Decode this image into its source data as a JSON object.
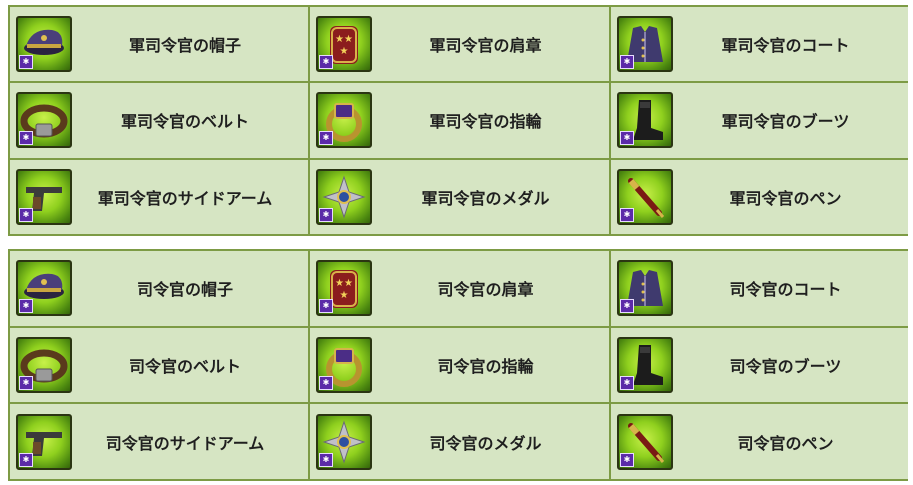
{
  "sections": [
    {
      "items": [
        {
          "label": "軍司令官の帽子",
          "icon": "officer-cap-icon"
        },
        {
          "label": "軍司令官の肩章",
          "icon": "epaulette-icon"
        },
        {
          "label": "軍司令官のコート",
          "icon": "coat-icon"
        },
        {
          "label": "軍司令官のベルト",
          "icon": "belt-icon"
        },
        {
          "label": "軍司令官の指輪",
          "icon": "ring-icon"
        },
        {
          "label": "軍司令官のブーツ",
          "icon": "boot-icon"
        },
        {
          "label": "軍司令官のサイドアーム",
          "icon": "pistol-icon"
        },
        {
          "label": "軍司令官のメダル",
          "icon": "medal-icon"
        },
        {
          "label": "軍司令官のペン",
          "icon": "pen-icon"
        }
      ]
    },
    {
      "items": [
        {
          "label": "司令官の帽子",
          "icon": "officer-cap-icon"
        },
        {
          "label": "司令官の肩章",
          "icon": "epaulette-icon"
        },
        {
          "label": "司令官のコート",
          "icon": "coat-icon"
        },
        {
          "label": "司令官のベルト",
          "icon": "belt-icon"
        },
        {
          "label": "司令官の指輪",
          "icon": "ring-icon"
        },
        {
          "label": "司令官のブーツ",
          "icon": "boot-icon"
        },
        {
          "label": "司令官のサイドアーム",
          "icon": "pistol-icon"
        },
        {
          "label": "司令官のメダル",
          "icon": "medal-icon"
        },
        {
          "label": "司令官のペン",
          "icon": "pen-icon"
        }
      ]
    }
  ],
  "colors": {
    "border": "#7d9b45",
    "cell": "#d6e5c3",
    "badge": "#5b2aa8",
    "icon_bg": "#8fd01e"
  }
}
